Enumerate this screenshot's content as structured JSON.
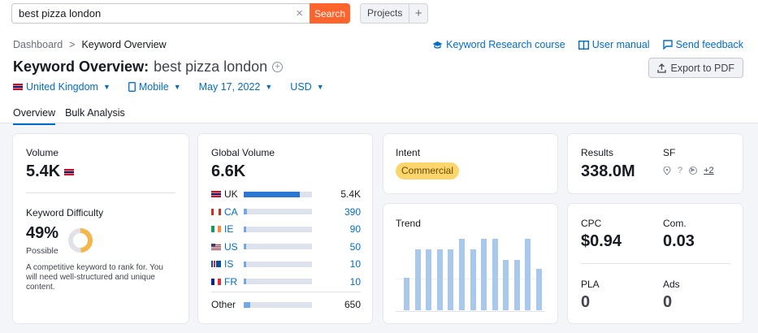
{
  "search": {
    "value": "best pizza london",
    "clear": "×",
    "button": "Search"
  },
  "projects": {
    "label": "Projects",
    "add": "+"
  },
  "breadcrumb": {
    "root": "Dashboard",
    "separator": ">",
    "current": "Keyword Overview"
  },
  "links": {
    "course": "Keyword Research course",
    "manual": "User manual",
    "feedback": "Send feedback"
  },
  "title": {
    "prefix": "Keyword Overview:",
    "keyword": "best pizza london",
    "add": "+"
  },
  "export": "Export to PDF",
  "filters": {
    "country": "United Kingdom",
    "device": "Mobile",
    "date": "May 17, 2022",
    "currency": "USD"
  },
  "tabs": [
    "Overview",
    "Bulk Analysis"
  ],
  "volume": {
    "label": "Volume",
    "value": "5.4K"
  },
  "difficulty": {
    "label": "Keyword Difficulty",
    "percent": 49,
    "value": "49%",
    "level": "Possible",
    "description": "A competitive keyword to rank for. You will need well-structured and unique content."
  },
  "global_volume": {
    "label": "Global Volume",
    "value": "6.6K",
    "rows": [
      {
        "country": "UK",
        "flag": "uk",
        "value": "5.4K",
        "share": 0.82
      },
      {
        "country": "CA",
        "flag": "ca",
        "value": "390",
        "share": 0.05
      },
      {
        "country": "IE",
        "flag": "ie",
        "value": "90",
        "share": 0.015
      },
      {
        "country": "US",
        "flag": "us",
        "value": "50",
        "share": 0.01
      },
      {
        "country": "IS",
        "flag": "is",
        "value": "10",
        "share": 0.005
      },
      {
        "country": "FR",
        "flag": "fr",
        "value": "10",
        "share": 0.005
      }
    ],
    "other": {
      "label": "Other",
      "value": "650",
      "share": 0.1
    }
  },
  "intent": {
    "label": "Intent",
    "value": "Commercial"
  },
  "trend": {
    "label": "Trend",
    "values": [
      0.45,
      0.85,
      0.85,
      0.85,
      0.85,
      1.0,
      0.85,
      1.0,
      1.0,
      0.7,
      0.7,
      1.0,
      0.58
    ]
  },
  "results": {
    "label": "Results",
    "value": "338.0M",
    "sf_label": "SF",
    "sf_more": "+2"
  },
  "cpc": {
    "label": "CPC",
    "value": "$0.94"
  },
  "com": {
    "label": "Com.",
    "value": "0.03"
  },
  "pla": {
    "label": "PLA",
    "value": "0"
  },
  "ads": {
    "label": "Ads",
    "value": "0"
  },
  "colors": {
    "accent": "#ff642d",
    "link": "#006dca",
    "bar": "#2d77d4",
    "trend_bar": "#a9c9ec",
    "intent_bg": "#fcd66c",
    "difficulty": "#f5b64a"
  }
}
